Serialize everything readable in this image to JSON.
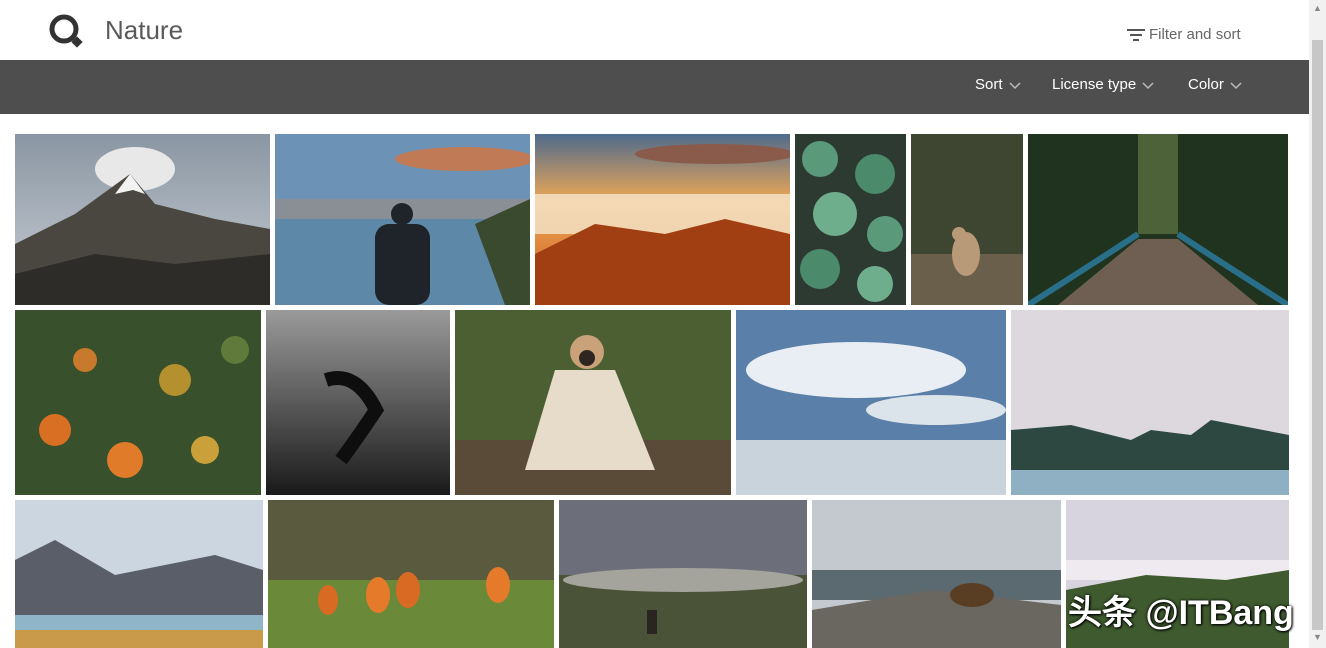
{
  "header": {
    "title": "Nature",
    "filter_label": "Filter and sort"
  },
  "toolbar": {
    "sort_label": "Sort",
    "license_label": "License type",
    "color_label": "Color"
  },
  "watermark": "头条 @ITBang",
  "icons": {
    "logo": "brand-logo-icon",
    "filter": "filter-icon",
    "chevron": "chevron-down-icon"
  },
  "colors": {
    "toolbar_bg": "#4e4e4e",
    "title_text": "#5a5a5a"
  },
  "photos": [
    "mountain-peak",
    "man-at-lake",
    "sunset-clouds",
    "succulents",
    "deer",
    "forest-bridge",
    "aerial-forest",
    "underwater-diver",
    "pug-in-blanket",
    "cloudy-sky-lake",
    "foggy-lake",
    "mountain-lake",
    "tulips",
    "hiker-on-cliff",
    "bear-on-rocks",
    "misty-hills"
  ]
}
